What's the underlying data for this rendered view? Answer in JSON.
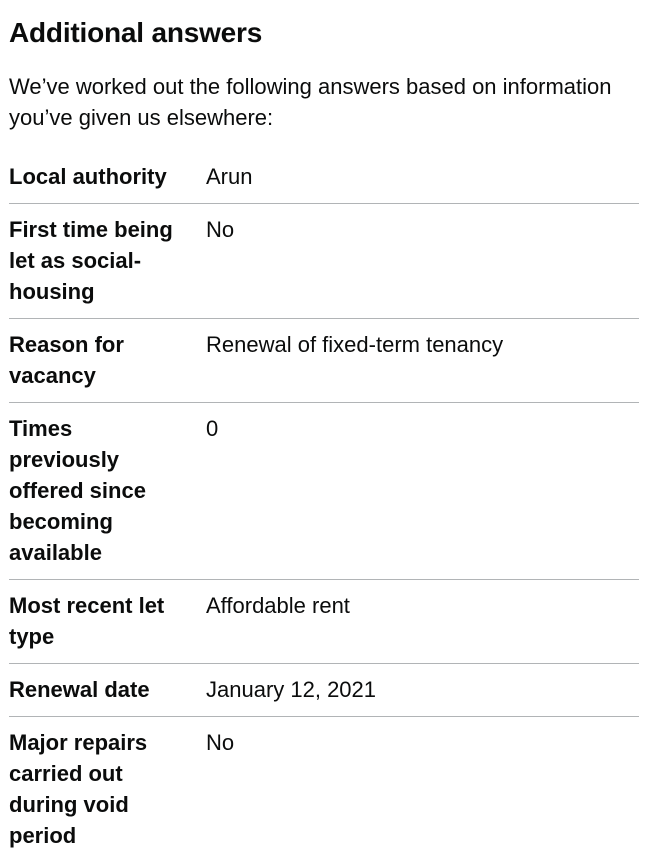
{
  "heading": "Additional answers",
  "intro": "We’ve worked out the following answers based on information you’ve given us elsewhere:",
  "rows": [
    {
      "key": "Local authority",
      "value": "Arun"
    },
    {
      "key": "First time being let as social-housing",
      "value": "No"
    },
    {
      "key": "Reason for vacancy",
      "value": "Renewal of fixed-term tenancy"
    },
    {
      "key": "Times previously offered since becoming available",
      "value": "0"
    },
    {
      "key": "Most recent let type",
      "value": "Affordable rent"
    },
    {
      "key": "Renewal date",
      "value": "January 12, 2021"
    },
    {
      "key": "Major repairs carried out during void period",
      "value": "No"
    }
  ]
}
